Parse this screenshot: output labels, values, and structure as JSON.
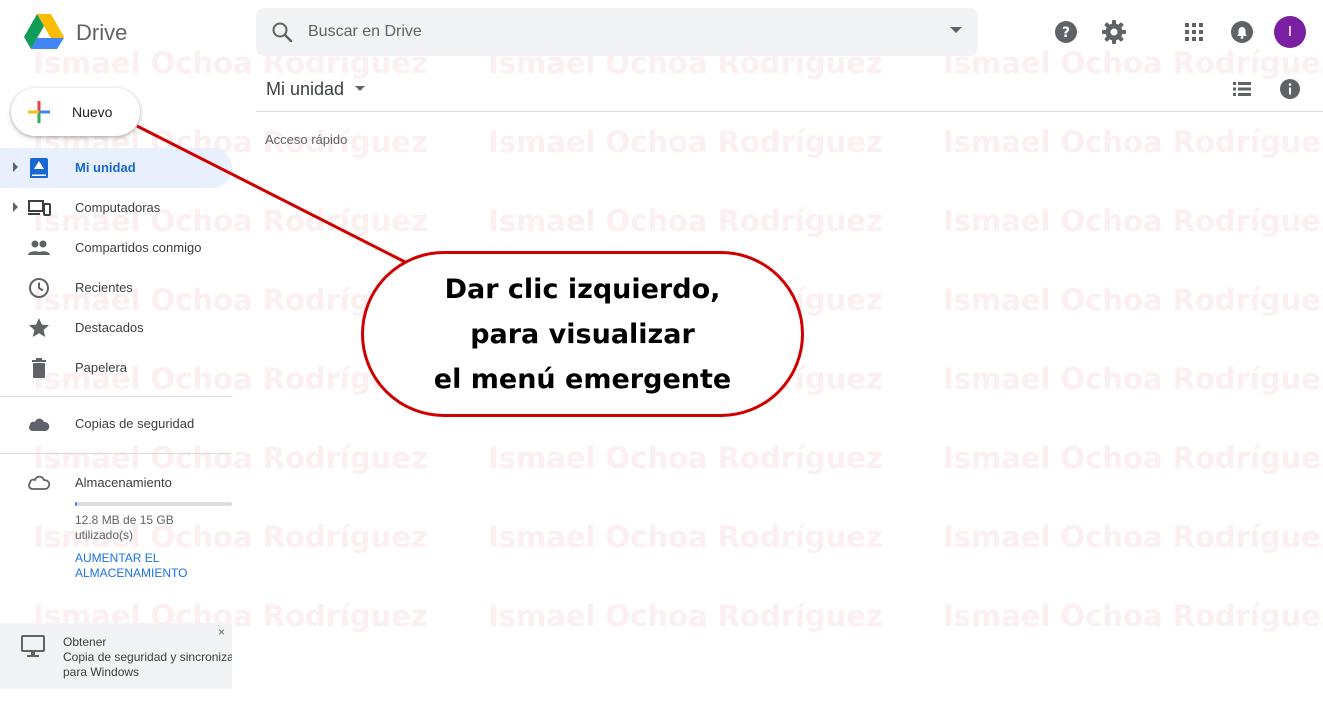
{
  "header": {
    "brand": "Drive",
    "search_placeholder": "Buscar en Drive",
    "avatar_initial": "I",
    "colors": {
      "avatar": "#7b1fa2"
    }
  },
  "sidebar": {
    "new_button": "Nuevo",
    "items": [
      {
        "label": "Mi unidad",
        "icon": "my-drive-icon",
        "active": true,
        "expandable": true
      },
      {
        "label": "Computadoras",
        "icon": "computers-icon",
        "expandable": true
      },
      {
        "label": "Compartidos conmigo",
        "icon": "shared-icon"
      },
      {
        "label": "Recientes",
        "icon": "clock-icon"
      },
      {
        "label": "Destacados",
        "icon": "star-icon"
      },
      {
        "label": "Papelera",
        "icon": "trash-icon"
      }
    ],
    "backup": {
      "label": "Copias de seguridad",
      "icon": "cloud-icon"
    },
    "storage": {
      "label": "Almacenamiento",
      "usage_line1": "12.8 MB de 15 GB",
      "usage_line2": "utilizado(s)",
      "used_fraction": 0.0008,
      "upgrade_line1": "AUMENTAR EL",
      "upgrade_line2": "ALMACENAMIENTO"
    },
    "promo": {
      "line1": "Obtener",
      "line2": "Copia de seguridad y sincronización",
      "line3": "para Windows",
      "close": "×"
    }
  },
  "main": {
    "title": "Mi unidad",
    "quick_access": "Acceso rápido"
  },
  "annotation": {
    "line1": "Dar clic izquierdo,",
    "line2": "para visualizar",
    "line3": "el menú emergente",
    "color": "#d00000"
  },
  "watermark": "Ismael Ochoa Rodríguez"
}
